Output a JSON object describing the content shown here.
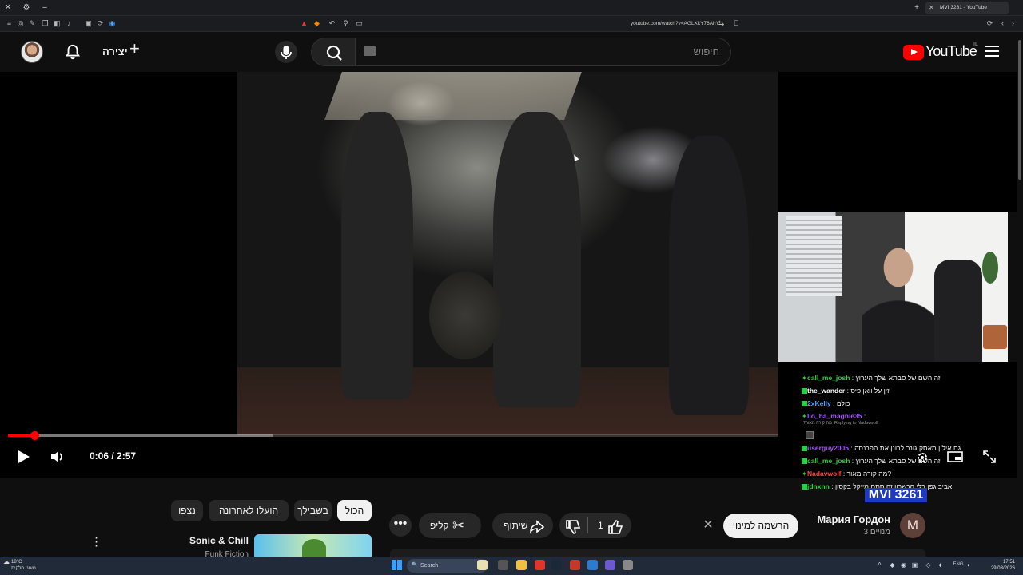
{
  "browser": {
    "tab_title": "MVI 3261 - YouTube",
    "url": "youtube.com/watch?v=AGLXkY76AhY"
  },
  "header": {
    "create_label": "יצירה",
    "search_placeholder": "חיפוש",
    "logo_text": "YouTube",
    "country_code": "IL"
  },
  "player": {
    "time": "0:06 / 2:57",
    "progress": 0.034,
    "buffered": 0.3446
  },
  "stream_chat": {
    "messages": [
      {
        "user": "call_me_josh",
        "text": "זה השם של סבתא שלך הערוץ",
        "color": "#2ecc40"
      },
      {
        "user": "the_wander",
        "text": "זין על וואן פיס",
        "color": "#ffffff"
      },
      {
        "user": "2xKelly",
        "text": "כולם",
        "color": "#4aa3ff"
      },
      {
        "user": "lio_ha_magnie35",
        "text": "",
        "color": "#a855f7"
      },
      {
        "user": "userguy2005",
        "text": "גם אילון מאסק גונב לרונן את הפרנסה",
        "color": "#a855f7"
      },
      {
        "user": "call_me_josh",
        "text": "זה השם של סבתא שלך הערוץ",
        "color": "#2ecc40"
      },
      {
        "user": "Nadavwolf",
        "text": "מה קורה מאור?",
        "color": "#ff4040"
      },
      {
        "user": "jdnxnn",
        "text": "אביב גפן בלי הכשרון זה סתם מייקל בקסון",
        "color": "#2ecc40"
      }
    ],
    "reply_text": "Replying to Nadavwolf: מה קורה מאור?"
  },
  "video": {
    "title": "MVI 3261"
  },
  "channel": {
    "name": "Мария Гордон",
    "subscribers": "3 מנויים",
    "avatar_letter": "M",
    "subscribe_label": "הרשמה למינוי"
  },
  "actions": {
    "like_count": "1",
    "share_label": "שיתוף",
    "clip_label": "קליפ"
  },
  "filter_chips": [
    {
      "label": "הכול",
      "selected": true
    },
    {
      "label": "בשבילך",
      "selected": false
    },
    {
      "label": "הועלו לאחרונה",
      "selected": false
    },
    {
      "label": "נצפו",
      "selected": false
    }
  ],
  "recommendation": {
    "title": "Sonic & Chill",
    "channel": "Funk Fiction"
  },
  "taskbar": {
    "weather_temp": "18°C",
    "weather_desc": "מעונן חלקית",
    "search_label": "Search",
    "time": "17:51",
    "date": "29/03/2026",
    "lang": "ENG"
  }
}
